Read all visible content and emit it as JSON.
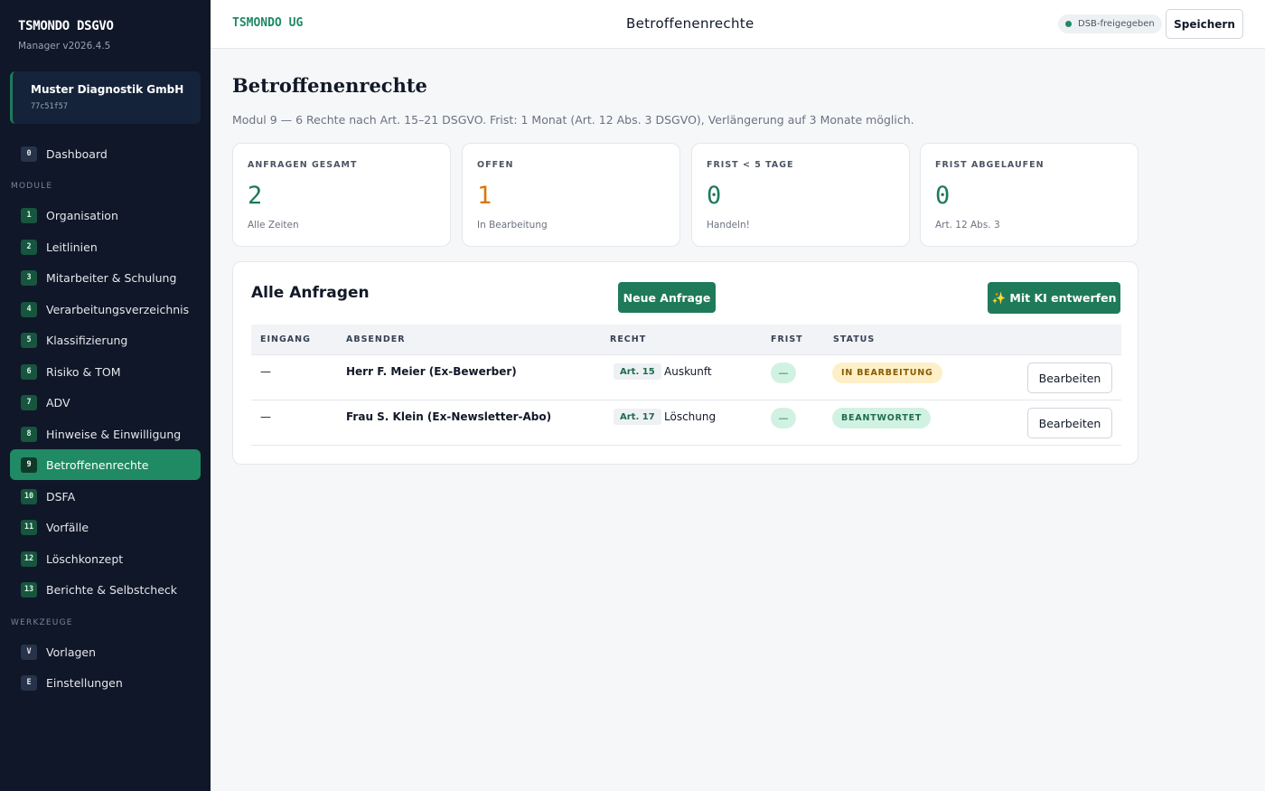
{
  "sidebar": {
    "brand": "TSMONDO DSGVO",
    "version": "Manager v2026.4.5",
    "org": {
      "name": "Muster Diagnostik GmbH",
      "id": "77c51f57"
    },
    "dashboard": {
      "badge": "0",
      "label": "Dashboard"
    },
    "modules_label": "MODULE",
    "modules": [
      {
        "badge": "1",
        "label": "Organisation"
      },
      {
        "badge": "2",
        "label": "Leitlinien"
      },
      {
        "badge": "3",
        "label": "Mitarbeiter & Schulung"
      },
      {
        "badge": "4",
        "label": "Verarbeitungsverzeichnis"
      },
      {
        "badge": "5",
        "label": "Klassifizierung"
      },
      {
        "badge": "6",
        "label": "Risiko & TOM"
      },
      {
        "badge": "7",
        "label": "ADV"
      },
      {
        "badge": "8",
        "label": "Hinweise & Einwilligung"
      },
      {
        "badge": "9",
        "label": "Betroffenenrechte"
      },
      {
        "badge": "10",
        "label": "DSFA"
      },
      {
        "badge": "11",
        "label": "Vorfälle"
      },
      {
        "badge": "12",
        "label": "Löschkonzept"
      },
      {
        "badge": "13",
        "label": "Berichte & Selbstcheck"
      }
    ],
    "tools_label": "WERKZEUGE",
    "tools": [
      {
        "badge": "V",
        "label": "Vorlagen"
      },
      {
        "badge": "E",
        "label": "Einstellungen"
      }
    ]
  },
  "header": {
    "company": "TSMONDO UG",
    "title": "Betroffenenrechte",
    "dsb_status": "DSB-freigegeben",
    "save_label": "Speichern"
  },
  "main": {
    "title": "Betroffenenrechte",
    "subtitle": "Modul 9 — 6 Rechte nach Art. 15–21 DSGVO. Frist: 1 Monat (Art. 12 Abs. 3 DSGVO), Verlängerung auf 3 Monate möglich.",
    "stats": [
      {
        "label": "ANFRAGEN GESAMT",
        "value": "2",
        "hint": "Alle Zeiten"
      },
      {
        "label": "OFFEN",
        "value": "1",
        "hint": "In Bearbeitung"
      },
      {
        "label": "FRIST < 5 TAGE",
        "value": "0",
        "hint": "Handeln!"
      },
      {
        "label": "FRIST ABGELAUFEN",
        "value": "0",
        "hint": "Art. 12 Abs. 3"
      }
    ],
    "panel": {
      "title": "Alle Anfragen",
      "new_button": "Neue Anfrage",
      "ai_button": "✨ Mit KI entwerfen",
      "columns": [
        "EINGANG",
        "ABSENDER",
        "RECHT",
        "FRIST",
        "STATUS"
      ],
      "rows": [
        {
          "eingang": "—",
          "absender": "Herr F. Meier (Ex-Bewerber)",
          "art": "Art. 15",
          "recht": "Auskunft",
          "frist": "—",
          "status": "IN BEARBEITUNG",
          "action": "Bearbeiten"
        },
        {
          "eingang": "—",
          "absender": "Frau S. Klein (Ex-Newsletter-Abo)",
          "art": "Art. 17",
          "recht": "Löschung",
          "frist": "—",
          "status": "BEANTWORTET",
          "action": "Bearbeiten"
        }
      ]
    }
  },
  "colors": {
    "accent": "#1f8a63",
    "sidebar_bg": "#0f1728",
    "warning": "#d97706"
  }
}
